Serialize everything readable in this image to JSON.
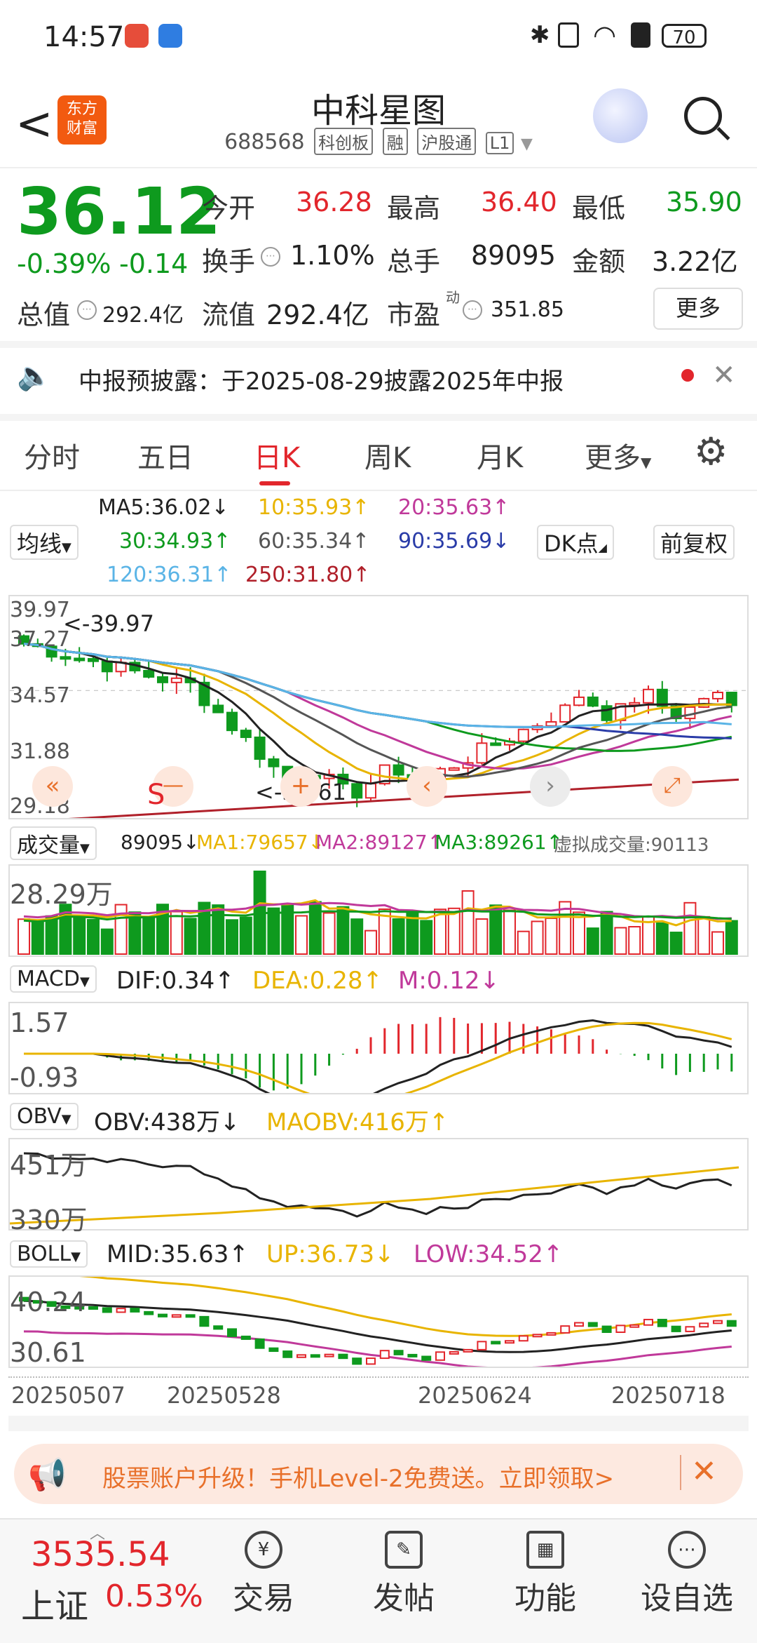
{
  "status": {
    "time": "14:57",
    "battery": "70"
  },
  "header": {
    "back": "<",
    "logo_line1": "东方",
    "logo_line2": "财富",
    "title": "中科星图",
    "code": "688568",
    "tags": [
      "科创板",
      "融",
      "沪股通",
      "L1"
    ]
  },
  "quote": {
    "price": "36.12",
    "change_pct": "-0.39%",
    "change": "-0.14",
    "open_label": "今开",
    "open": "36.28",
    "high_label": "最高",
    "high": "36.40",
    "low_label": "最低",
    "low": "35.90",
    "turnover_label": "换手",
    "turnover": "1.10%",
    "volume_label": "总手",
    "volume": "89095",
    "amount_label": "金额",
    "amount": "3.22亿",
    "mktcap_label": "总值",
    "mktcap": "292.4亿",
    "float_label": "流值",
    "float_cap": "292.4亿",
    "pe_label": "市盈",
    "pe_sup": "动",
    "pe": "351.85",
    "more": "更多"
  },
  "notice": {
    "text": "中报预披露：于2025-08-29披露2025年中报"
  },
  "tabs": [
    "分时",
    "五日",
    "日K",
    "周K",
    "月K",
    "更多"
  ],
  "ma": {
    "selector": "均线",
    "ma5": "MA5:36.02↓",
    "ma10": "10:35.93↑",
    "ma20": "20:35.63↑",
    "ma30": "30:34.93↑",
    "ma60": "60:35.34↑",
    "ma90": "90:35.69↓",
    "ma120": "120:36.31↑",
    "ma250": "250:31.80↑",
    "dk": "DK点",
    "adjust": "前复权"
  },
  "kline": {
    "y_labels": [
      "39.97",
      "37.27",
      "34.57",
      "31.88",
      "29.18"
    ],
    "max_label": "<-39.97",
    "min_label": "<-30.61"
  },
  "volume": {
    "selector": "成交量",
    "value": "89095↓",
    "ma1": "MA1:79657↓",
    "ma2": "MA2:89127↑",
    "ma3": "MA3:89261↑",
    "virtual": "虚拟成交量:90113",
    "y_label": "28.29万"
  },
  "macd": {
    "selector": "MACD",
    "dif": "DIF:0.34↑",
    "dea": "DEA:0.28↑",
    "m": "M:0.12↓",
    "y_top": "1.57",
    "y_bottom": "-0.93"
  },
  "obv": {
    "selector": "OBV",
    "obv": "OBV:438万↓",
    "maobv": "MAOBV:416万↑",
    "y_top": "451万",
    "y_bottom": "330万"
  },
  "boll": {
    "selector": "BOLL",
    "mid": "MID:35.63↑",
    "up": "UP:36.73↓",
    "low": "LOW:34.52↑",
    "y_top": "40.24",
    "y_bottom": "30.61"
  },
  "dates": [
    "20250507",
    "20250528",
    "20250624",
    "20250718"
  ],
  "ad": {
    "text": "股票账户升级！手机Level-2免费送。立即领取>"
  },
  "bottom": {
    "index_value": "3535.54",
    "index_name": "上证",
    "index_change": "0.53%",
    "items": [
      "交易",
      "发帖",
      "功能",
      "设自选"
    ]
  },
  "colors": {
    "up": "#e2262c",
    "down": "#0e9a1e",
    "ma5": "#222222",
    "ma10": "#e8b400",
    "ma20": "#c0399a",
    "ma30": "#0e9a1e",
    "ma60": "#555555",
    "ma90": "#2a3ca8",
    "ma120": "#5ab4e6",
    "ma250": "#b0202a"
  }
}
